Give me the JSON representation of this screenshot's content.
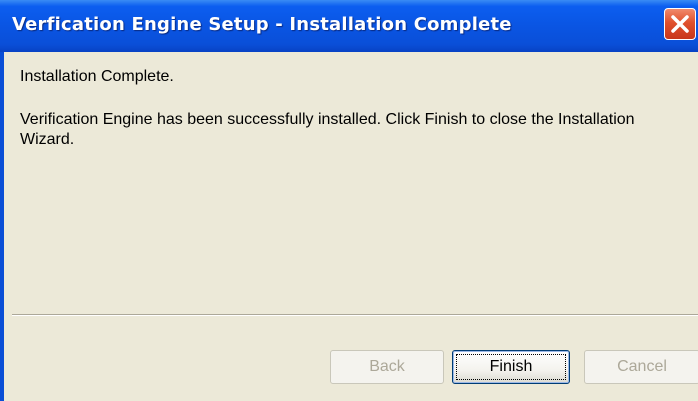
{
  "window": {
    "title": "Verfication Engine Setup - Installation Complete"
  },
  "content": {
    "heading": "Installation Complete.",
    "message": "Verification Engine has been successfully installed.  Click Finish to close the Installation Wizard."
  },
  "buttons": {
    "back_label": "Back",
    "finish_label": "Finish",
    "cancel_label": "Cancel"
  },
  "icons": {
    "close": "close-icon"
  },
  "colors": {
    "titlebar": "#0a55e3",
    "close_button": "#e0502c",
    "dialog_background": "#ece9d8",
    "disabled_text": "#aca899"
  }
}
